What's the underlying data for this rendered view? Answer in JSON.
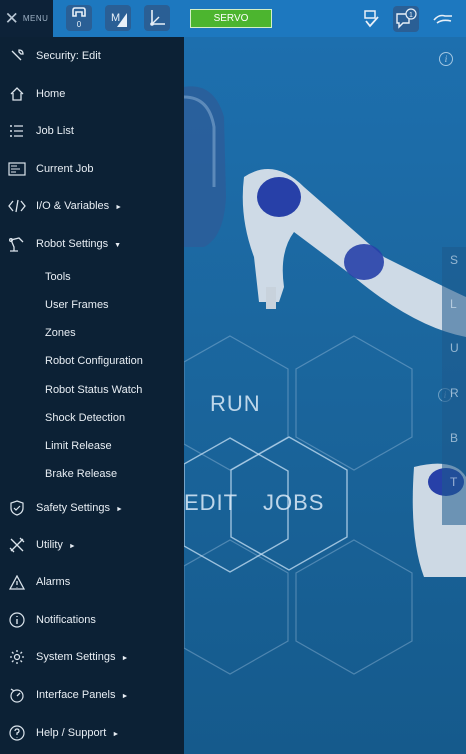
{
  "topbar": {
    "menu_label": "MENU",
    "robot_badge": "0",
    "servo_label": "SERVO",
    "notification_count": "1",
    "mode_icon_text": "M"
  },
  "sidebar": {
    "items": [
      {
        "label": "Security: Edit",
        "icon": "wrench-icon"
      },
      {
        "label": "Home",
        "icon": "home-icon"
      },
      {
        "label": "Job List",
        "icon": "list-icon"
      },
      {
        "label": "Current Job",
        "icon": "job-file-icon"
      },
      {
        "label": "I/O & Variables",
        "icon": "code-icon",
        "arrow": "►"
      },
      {
        "label": "Robot Settings",
        "icon": "robot-arm-icon",
        "arrow": "▼"
      },
      {
        "label": "Safety Settings",
        "icon": "shield-icon",
        "arrow": "►"
      },
      {
        "label": "Utility",
        "icon": "tools-icon",
        "arrow": "►"
      },
      {
        "label": "Alarms",
        "icon": "warning-icon"
      },
      {
        "label": "Notifications",
        "icon": "info-icon"
      },
      {
        "label": "System Settings",
        "icon": "gear-icon",
        "arrow": "►"
      },
      {
        "label": "Interface Panels",
        "icon": "dial-icon",
        "arrow": "►"
      },
      {
        "label": "Help / Support",
        "icon": "help-icon",
        "arrow": "►"
      }
    ],
    "robot_settings_sub": [
      {
        "label": "Tools"
      },
      {
        "label": "User Frames"
      },
      {
        "label": "Zones"
      },
      {
        "label": "Robot Configuration"
      },
      {
        "label": "Robot Status Watch"
      },
      {
        "label": "Shock Detection"
      },
      {
        "label": "Limit Release"
      },
      {
        "label": "Brake Release"
      }
    ]
  },
  "main": {
    "tiles": {
      "run": "RUN",
      "edit": "EDIT",
      "jobs": "JOBS"
    },
    "axis_tabs": [
      "S",
      "L",
      "U",
      "R",
      "B",
      "T"
    ]
  },
  "colors": {
    "sidebar_bg": "#0c2135",
    "topbar_bg": "#1d78bf",
    "servo_green": "#4cb52f",
    "main_bg": "#1b679f"
  }
}
